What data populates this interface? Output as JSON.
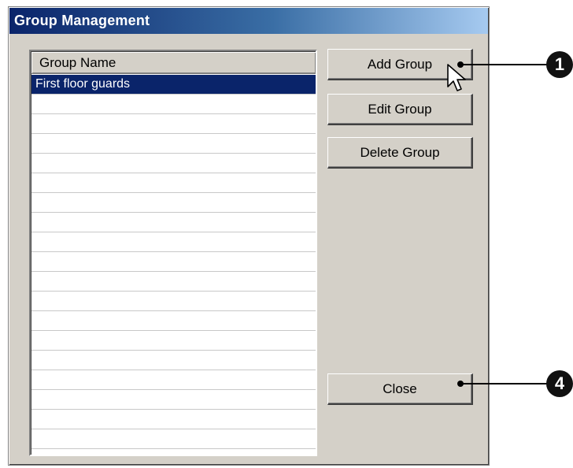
{
  "window": {
    "title": "Group Management"
  },
  "group_list": {
    "column_header": "Group Name",
    "rows": [
      "First floor guards",
      "",
      "",
      "",
      "",
      "",
      "",
      "",
      "",
      "",
      "",
      "",
      "",
      "",
      "",
      "",
      "",
      "",
      "",
      ""
    ],
    "selected_index": 0
  },
  "buttons": {
    "add_group": "Add Group",
    "edit_group": "Edit Group",
    "delete_group": "Delete Group",
    "close": "Close"
  },
  "callouts": {
    "add_group_callout": "1",
    "close_callout": "4"
  },
  "colors": {
    "selection": "#0a246a",
    "dialog_face": "#d4d0c8",
    "title_gradient_start": "#0a246a",
    "title_gradient_end": "#a6caf0"
  },
  "icons": {
    "cursor": "arrow-cursor-icon"
  }
}
